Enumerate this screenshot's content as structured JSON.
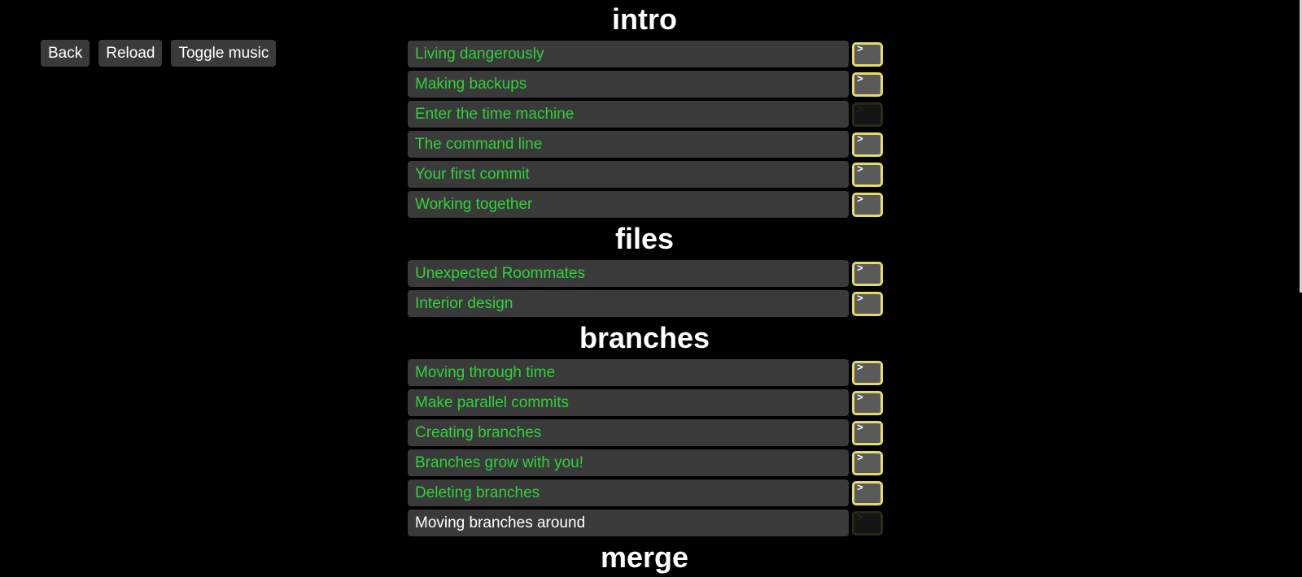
{
  "toolbar": {
    "back_label": "Back",
    "reload_label": "Reload",
    "toggle_music_label": "Toggle music"
  },
  "chapters": [
    {
      "title": "intro",
      "levels": [
        {
          "name": "Living dangerously",
          "solved": true,
          "terminal_enabled": true
        },
        {
          "name": "Making backups",
          "solved": true,
          "terminal_enabled": true
        },
        {
          "name": "Enter the time machine",
          "solved": true,
          "terminal_enabled": false
        },
        {
          "name": "The command line",
          "solved": true,
          "terminal_enabled": true
        },
        {
          "name": "Your first commit",
          "solved": true,
          "terminal_enabled": true
        },
        {
          "name": "Working together",
          "solved": true,
          "terminal_enabled": true
        }
      ]
    },
    {
      "title": "files",
      "levels": [
        {
          "name": "Unexpected Roommates",
          "solved": true,
          "terminal_enabled": true
        },
        {
          "name": "Interior design",
          "solved": true,
          "terminal_enabled": true
        }
      ]
    },
    {
      "title": "branches",
      "levels": [
        {
          "name": "Moving through time",
          "solved": true,
          "terminal_enabled": true
        },
        {
          "name": "Make parallel commits",
          "solved": true,
          "terminal_enabled": true
        },
        {
          "name": "Creating branches",
          "solved": true,
          "terminal_enabled": true
        },
        {
          "name": "Branches grow with you!",
          "solved": true,
          "terminal_enabled": true
        },
        {
          "name": "Deleting branches",
          "solved": true,
          "terminal_enabled": true
        },
        {
          "name": "Moving branches around",
          "solved": false,
          "terminal_enabled": false
        }
      ]
    },
    {
      "title": "merge",
      "levels": []
    }
  ],
  "terminal_prompt_glyph": ">",
  "colors": {
    "background": "#000000",
    "row_background": "#3a3a3a",
    "solved_text": "#2fd23a",
    "unsolved_text": "#ffffff",
    "terminal_border": "#e2db66",
    "chapter_title": "#ffffff"
  }
}
